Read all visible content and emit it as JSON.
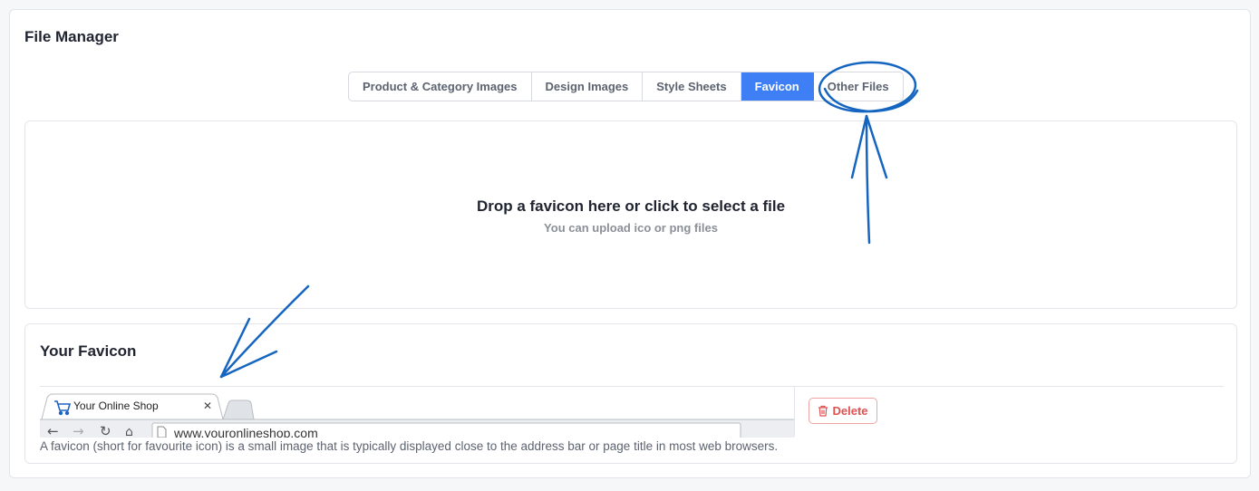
{
  "page": {
    "title": "File Manager"
  },
  "tabs": [
    {
      "label": "Product & Category Images",
      "active": false
    },
    {
      "label": "Design Images",
      "active": false
    },
    {
      "label": "Style Sheets",
      "active": false
    },
    {
      "label": "Favicon",
      "active": true
    },
    {
      "label": "Other Files",
      "active": false
    }
  ],
  "dropzone": {
    "title": "Drop a favicon here or click to select a file",
    "subtitle": "You can upload ico or png files"
  },
  "favicon": {
    "title": "Your Favicon",
    "preview": {
      "tab_title": "Your Online Shop",
      "url": "www.youronlineshop.com"
    },
    "delete_label": "Delete",
    "description": "A favicon (short for favourite icon) is a small image that is typically displayed close to the address bar or page title in most web browsers."
  },
  "colors": {
    "accent": "#3f7ff5",
    "danger": "#e05252",
    "annotation": "#1565c0"
  }
}
